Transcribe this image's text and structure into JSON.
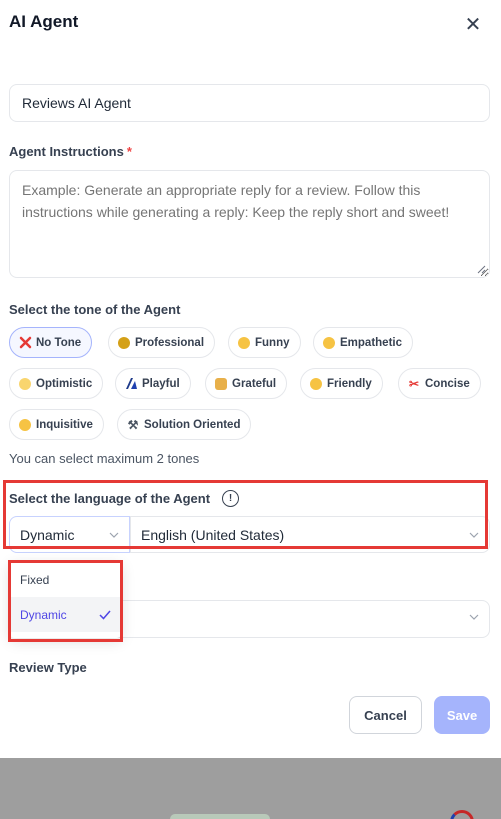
{
  "modal": {
    "title": "AI Agent",
    "close_icon": "close-icon"
  },
  "agent_name": {
    "value": "Reviews AI Agent"
  },
  "instructions": {
    "label": "Agent Instructions",
    "required_marker": "*",
    "placeholder": "Example: Generate an appropriate reply for a review. Follow this instructions while generating a reply: Keep the reply short and sweet!"
  },
  "tone": {
    "label": "Select the tone of the Agent",
    "hint": "You can select maximum 2 tones",
    "chips": [
      {
        "label": "No Tone",
        "icon": "cross-icon",
        "selected": true
      },
      {
        "label": "Professional",
        "icon": "professional-icon",
        "selected": false
      },
      {
        "label": "Funny",
        "icon": "laughing-face-icon",
        "selected": false
      },
      {
        "label": "Empathetic",
        "icon": "smiling-face-icon",
        "selected": false
      },
      {
        "label": "Optimistic",
        "icon": "sunrise-icon",
        "selected": false
      },
      {
        "label": "Playful",
        "icon": "playful-icon",
        "selected": false
      },
      {
        "label": "Grateful",
        "icon": "folded-hands-icon",
        "selected": false
      },
      {
        "label": "Friendly",
        "icon": "smile-icon",
        "selected": false
      },
      {
        "label": "Concise",
        "icon": "scissors-icon",
        "selected": false
      },
      {
        "label": "Inquisitive",
        "icon": "thinking-face-icon",
        "selected": false
      },
      {
        "label": "Solution Oriented",
        "icon": "tools-icon",
        "selected": false
      }
    ]
  },
  "language": {
    "label": "Select the language of the Agent",
    "mode_value": "Dynamic",
    "language_value": "English (United States)",
    "mode_options": [
      {
        "label": "Fixed",
        "selected": false
      },
      {
        "label": "Dynamic",
        "selected": true
      }
    ]
  },
  "review_type": {
    "label": "Review Type"
  },
  "footer": {
    "cancel_label": "Cancel",
    "save_label": "Save"
  },
  "colors": {
    "accent": "#a5b4fc",
    "highlight": "#e53935",
    "required": "#ef4444"
  }
}
